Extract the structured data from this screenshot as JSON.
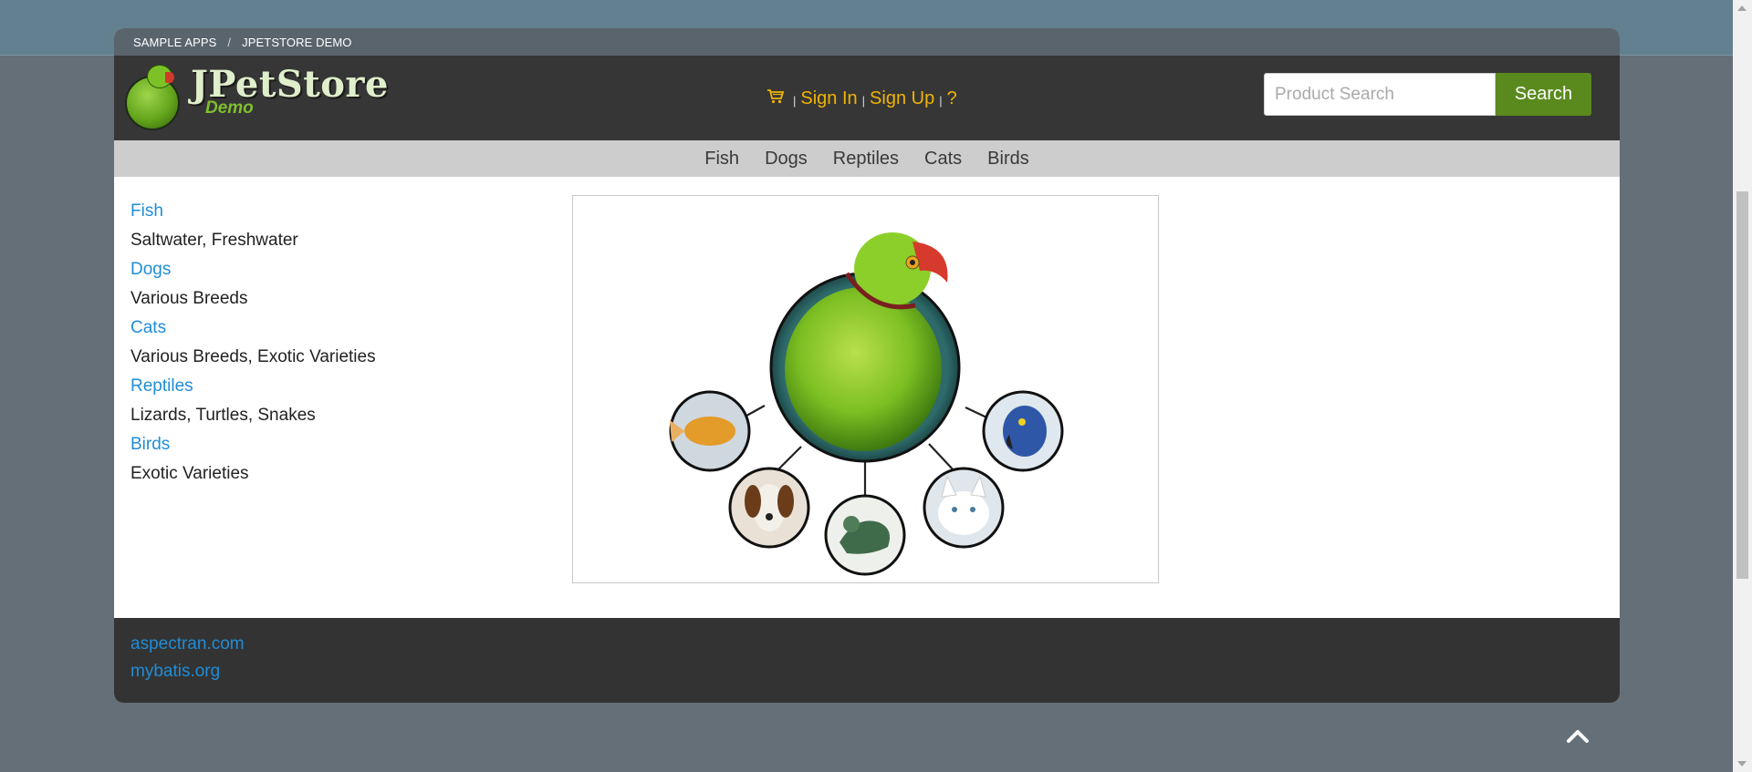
{
  "breadcrumb": {
    "items": [
      "SAMPLE APPS",
      "JPETSTORE DEMO"
    ],
    "separator": "/"
  },
  "header": {
    "logo_title": "JPetStore",
    "logo_subtitle": "Demo",
    "cart_icon": "cart-icon",
    "sign_in": "Sign In",
    "sign_up": "Sign Up",
    "help": "?",
    "separator": "|",
    "search": {
      "placeholder": "Product Search",
      "value": "",
      "button_label": "Search"
    }
  },
  "category_nav": [
    "Fish",
    "Dogs",
    "Reptiles",
    "Cats",
    "Birds"
  ],
  "sidebar": [
    {
      "label": "Fish",
      "description": "Saltwater, Freshwater"
    },
    {
      "label": "Dogs",
      "description": "Various Breeds"
    },
    {
      "label": "Cats",
      "description": "Various Breeds, Exotic Varieties"
    },
    {
      "label": "Reptiles",
      "description": "Lizards, Turtles, Snakes"
    },
    {
      "label": "Birds",
      "description": "Exotic Varieties"
    }
  ],
  "footer": {
    "links": [
      "aspectran.com",
      "mybatis.org"
    ]
  },
  "colors": {
    "accent_link": "#1f8dd6",
    "user_link": "#f0b400",
    "search_button": "#5a8a1e",
    "header_bg": "#363636"
  }
}
